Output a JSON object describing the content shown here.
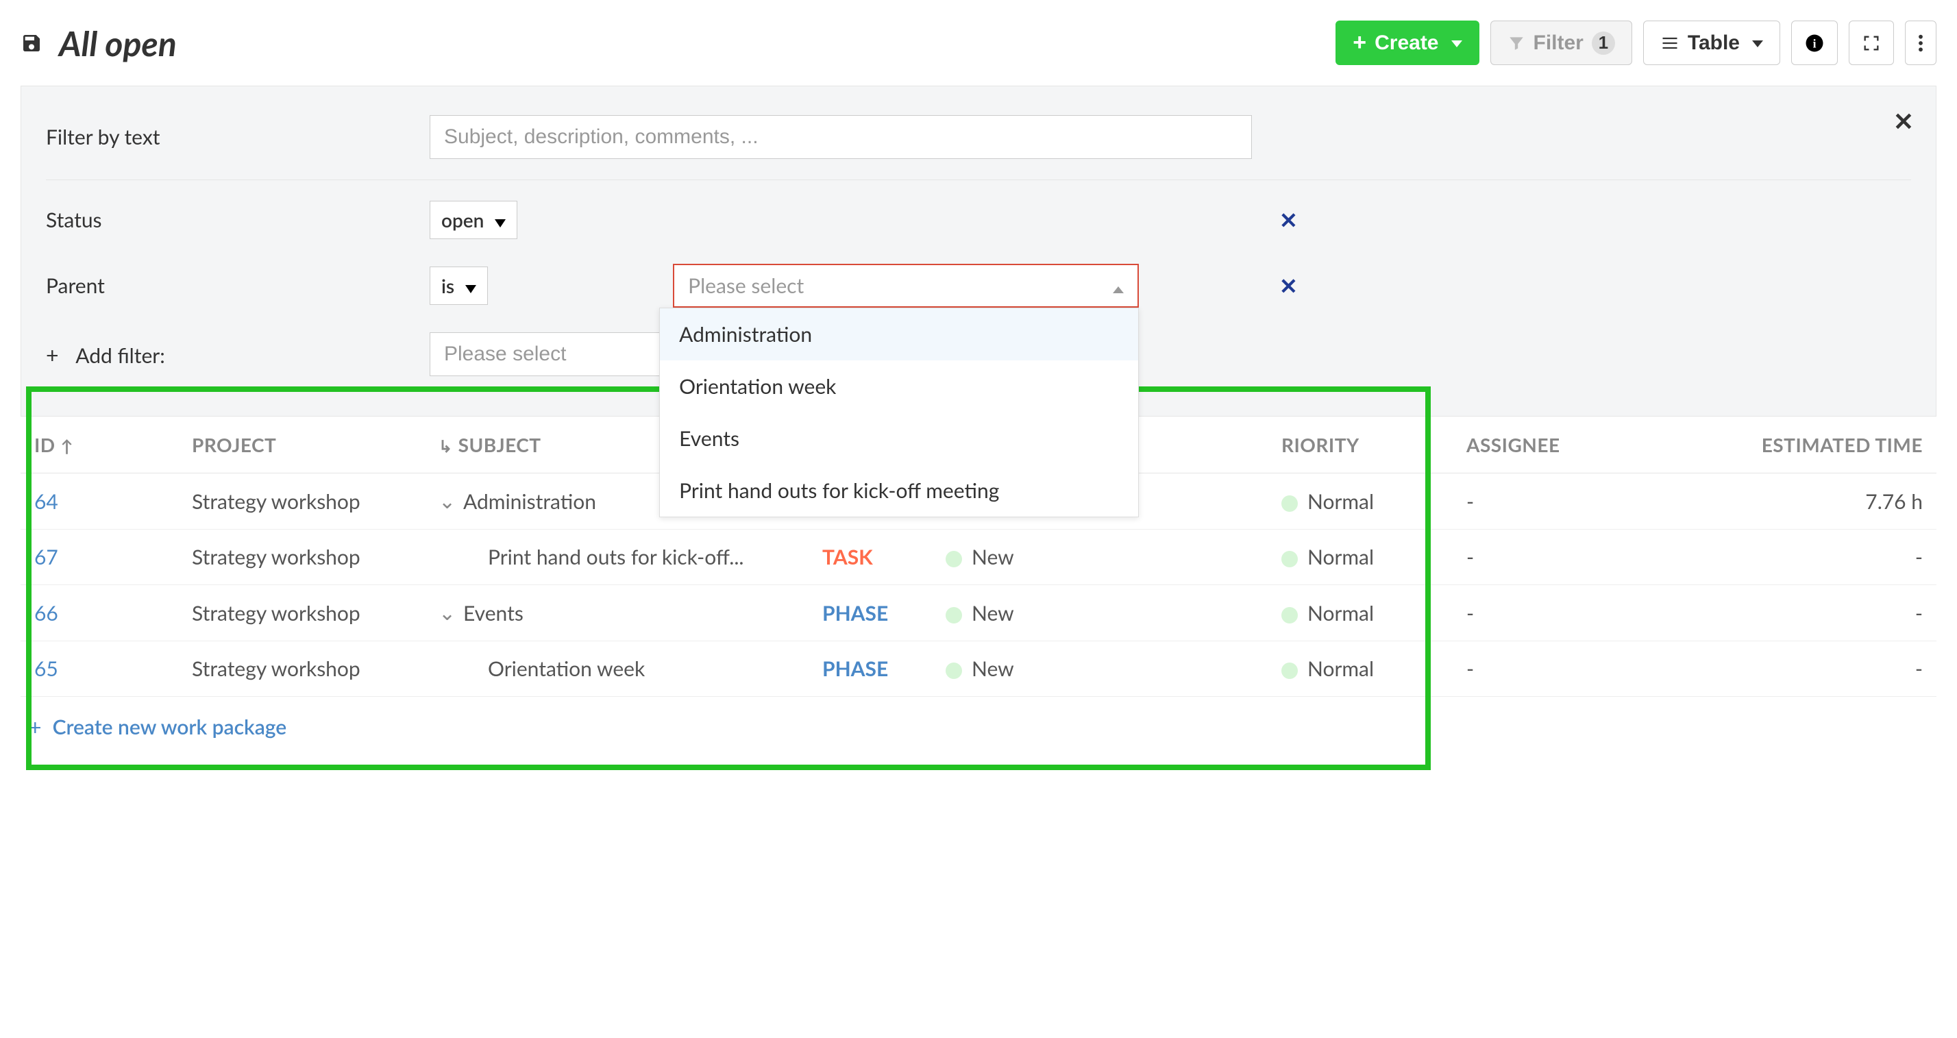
{
  "header": {
    "title": "All open",
    "create_label": "Create",
    "filter_label": "Filter",
    "filter_count": "1",
    "table_label": "Table"
  },
  "filterPanel": {
    "close": "✕",
    "textRow": {
      "label": "Filter by text",
      "placeholder": "Subject, description, comments, ..."
    },
    "statusRow": {
      "label": "Status",
      "value": "open"
    },
    "parentRow": {
      "label": "Parent",
      "operator": "is",
      "placeholder": "Please select",
      "options": [
        "Administration",
        "Orientation week",
        "Events",
        "Print hand outs for kick-off meeting"
      ]
    },
    "addFilter": {
      "label": "Add filter:",
      "placeholder": "Please select"
    }
  },
  "table": {
    "columns": {
      "id": "ID",
      "project": "PROJECT",
      "subject": "SUBJECT",
      "priority": "RIORITY",
      "assignee": "ASSIGNEE",
      "estimated": "ESTIMATED TIME"
    },
    "rows": [
      {
        "id": "64",
        "project": "Strategy workshop",
        "hasChildren": true,
        "subject": "Administration",
        "type": "",
        "typeClass": "",
        "status": "",
        "priority": "Normal",
        "assignee": "-",
        "estimated": "7.76 h"
      },
      {
        "id": "67",
        "project": "Strategy workshop",
        "hasChildren": false,
        "indent": true,
        "subject": "Print hand outs for kick-off...",
        "type": "TASK",
        "typeClass": "type-task",
        "status": "New",
        "priority": "Normal",
        "assignee": "-",
        "estimated": "-"
      },
      {
        "id": "66",
        "project": "Strategy workshop",
        "hasChildren": true,
        "subject": "Events",
        "type": "PHASE",
        "typeClass": "type-phase",
        "status": "New",
        "priority": "Normal",
        "assignee": "-",
        "estimated": "-"
      },
      {
        "id": "65",
        "project": "Strategy workshop",
        "hasChildren": false,
        "indent": true,
        "subject": "Orientation week",
        "type": "PHASE",
        "typeClass": "type-phase",
        "status": "New",
        "priority": "Normal",
        "assignee": "-",
        "estimated": "-"
      }
    ],
    "createLink": "Create new work package"
  }
}
